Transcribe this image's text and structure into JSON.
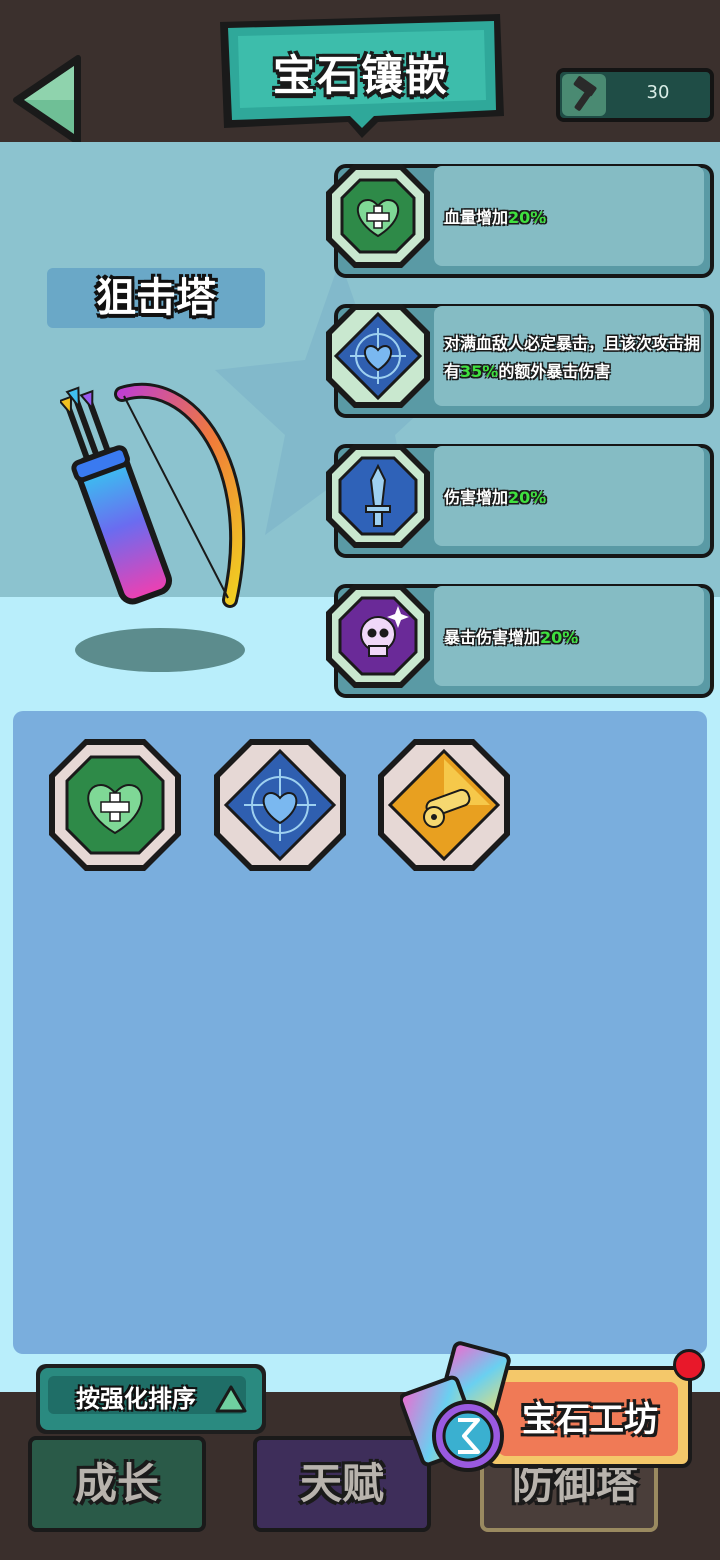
{
  "header": {
    "title": "宝石镶嵌",
    "back_icon": "back-arrow-icon",
    "currency": {
      "icon": "hammer-icon",
      "value": "30"
    }
  },
  "tower": {
    "name": "狙击塔",
    "art": "bow-and-quiver"
  },
  "gem_slots": [
    {
      "icon": "green-heart-gem-icon",
      "text_before": "血量增加",
      "highlight": "20%",
      "text_after": ""
    },
    {
      "icon": "blue-broken-heart-gem-icon",
      "text_before": "对满血敌人必定暴击，且该次攻击拥有",
      "highlight": "35%",
      "text_after": "的额外暴击伤害"
    },
    {
      "icon": "blue-sword-gem-icon",
      "text_before": "伤害增加",
      "highlight": "20%",
      "text_after": ""
    },
    {
      "icon": "purple-skull-gem-icon",
      "text_before": "暴击伤害增加",
      "highlight": "20%",
      "text_after": ""
    }
  ],
  "inventory": [
    {
      "icon": "green-heart-gem-icon"
    },
    {
      "icon": "blue-broken-heart-gem-icon"
    },
    {
      "icon": "gold-cannon-gem-icon"
    }
  ],
  "sort_button": {
    "label": "按强化排序",
    "icon": "triangle-up-icon"
  },
  "tabs": [
    {
      "label": "成长"
    },
    {
      "label": "天赋"
    },
    {
      "label": "防御塔"
    }
  ],
  "workshop_button": {
    "label": "宝石工坊",
    "badge_color": "#e8182a"
  },
  "colors": {
    "highlight": "#3fe03f",
    "accent": "#2a8a80"
  }
}
